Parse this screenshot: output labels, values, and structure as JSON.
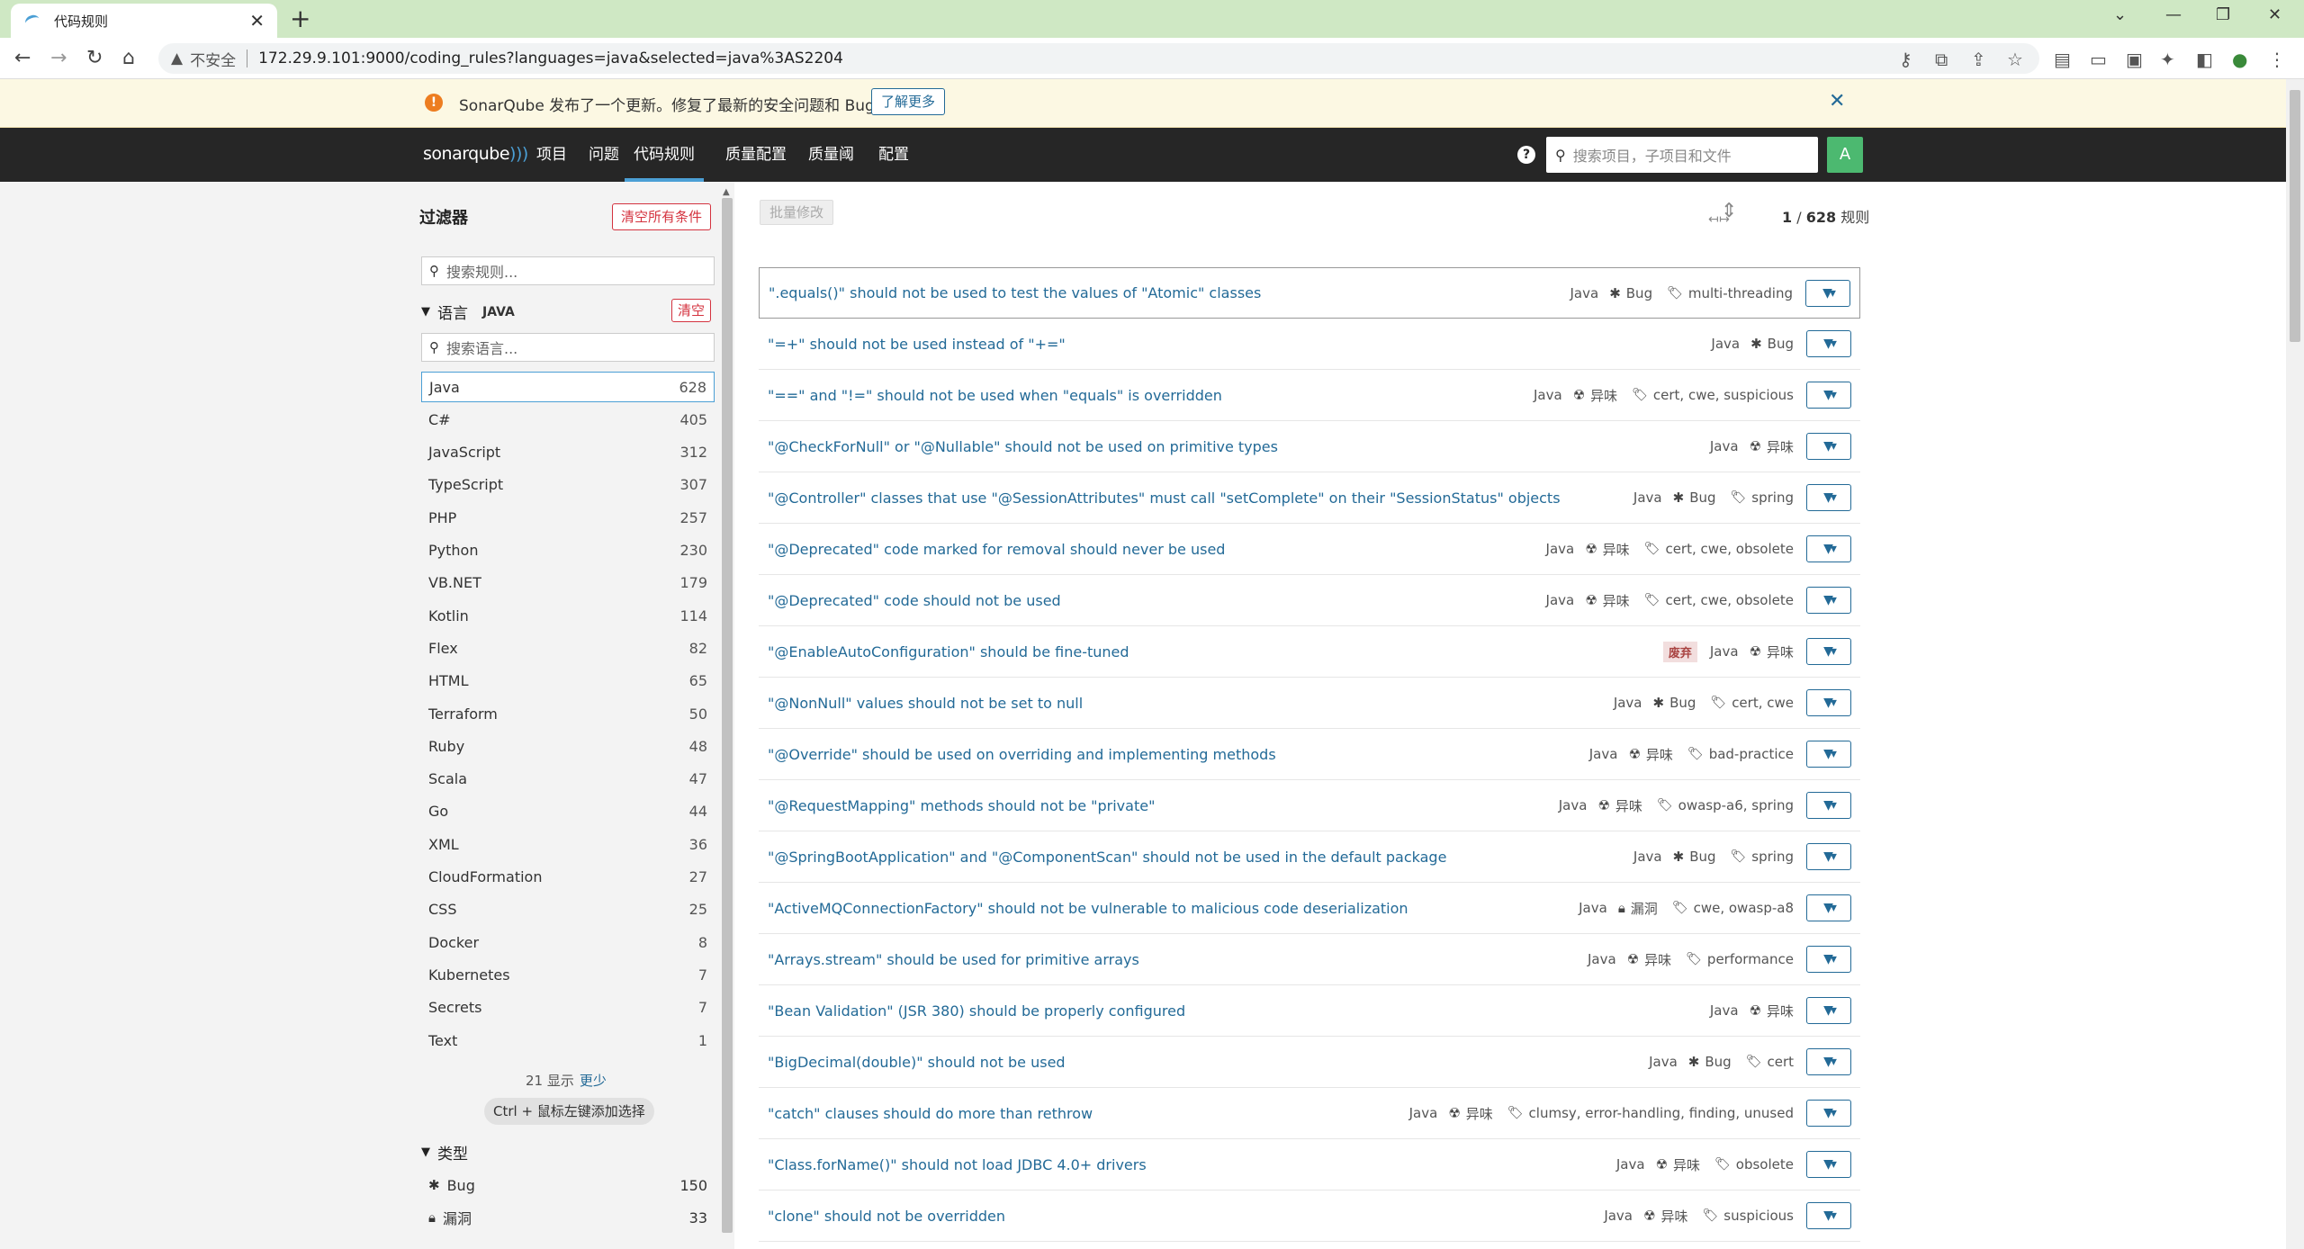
{
  "browser": {
    "tab_title": "代码规则",
    "insecure_label": "不安全",
    "url": "172.29.9.101:9000/coding_rules?languages=java&selected=java%3AS2204"
  },
  "notice": {
    "message": "SonarQube 发布了一个更新。修复了最新的安全问题和 Bug。",
    "learn_more": "了解更多"
  },
  "nav": {
    "logo": "sonarqube",
    "items": [
      "项目",
      "问题",
      "代码规则",
      "质量配置",
      "质量阈",
      "配置"
    ],
    "active": "代码规则",
    "search_placeholder": "搜索项目，子项目和文件",
    "avatar": "A"
  },
  "sidebar": {
    "title": "过滤器",
    "clear_all": "清空所有条件",
    "search_placeholder": "搜索规则...",
    "language_facet": {
      "label": "语言",
      "selected": "JAVA",
      "clear": "清空",
      "search_placeholder": "搜索语言...",
      "items": [
        {
          "name": "Java",
          "count": "628"
        },
        {
          "name": "C#",
          "count": "405"
        },
        {
          "name": "JavaScript",
          "count": "312"
        },
        {
          "name": "TypeScript",
          "count": "307"
        },
        {
          "name": "PHP",
          "count": "257"
        },
        {
          "name": "Python",
          "count": "230"
        },
        {
          "name": "VB.NET",
          "count": "179"
        },
        {
          "name": "Kotlin",
          "count": "114"
        },
        {
          "name": "Flex",
          "count": "82"
        },
        {
          "name": "HTML",
          "count": "65"
        },
        {
          "name": "Terraform",
          "count": "50"
        },
        {
          "name": "Ruby",
          "count": "48"
        },
        {
          "name": "Scala",
          "count": "47"
        },
        {
          "name": "Go",
          "count": "44"
        },
        {
          "name": "XML",
          "count": "36"
        },
        {
          "name": "CloudFormation",
          "count": "27"
        },
        {
          "name": "CSS",
          "count": "25"
        },
        {
          "name": "Docker",
          "count": "8"
        },
        {
          "name": "Kubernetes",
          "count": "7"
        },
        {
          "name": "Secrets",
          "count": "7"
        },
        {
          "name": "Text",
          "count": "1"
        }
      ],
      "shown": "21 显示",
      "show_less": "更少",
      "ctrl_hint": "Ctrl + 鼠标左键添加选择"
    },
    "type_facet": {
      "label": "类型",
      "items": [
        {
          "name": "Bug",
          "count": "150",
          "icon": "bug-icon"
        },
        {
          "name": "漏洞",
          "count": "33",
          "icon": "lock-icon"
        }
      ]
    }
  },
  "main": {
    "bulk_change": "批量修改",
    "paging_current": "1",
    "paging_sep": " / ",
    "paging_total": "628",
    "paging_unit": " 规则",
    "rules": [
      {
        "name": "\".equals()\" should not be used to test the values of \"Atomic\" classes",
        "lang": "Java",
        "type": "Bug",
        "icon": "bug-icon",
        "tags": "multi-threading",
        "deprecated": ""
      },
      {
        "name": "\"=+\" should not be used instead of \"+=\"",
        "lang": "Java",
        "type": "Bug",
        "icon": "bug-icon",
        "tags": "",
        "deprecated": ""
      },
      {
        "name": "\"==\" and \"!=\" should not be used when \"equals\" is overridden",
        "lang": "Java",
        "type": "异味",
        "icon": "code-smell-icon",
        "tags": "cert, cwe, suspicious",
        "deprecated": ""
      },
      {
        "name": "\"@CheckForNull\" or \"@Nullable\" should not be used on primitive types",
        "lang": "Java",
        "type": "异味",
        "icon": "code-smell-icon",
        "tags": "",
        "deprecated": ""
      },
      {
        "name": "\"@Controller\" classes that use \"@SessionAttributes\" must call \"setComplete\" on their \"SessionStatus\" objects",
        "lang": "Java",
        "type": "Bug",
        "icon": "bug-icon",
        "tags": "spring",
        "deprecated": ""
      },
      {
        "name": "\"@Deprecated\" code marked for removal should never be used",
        "lang": "Java",
        "type": "异味",
        "icon": "code-smell-icon",
        "tags": "cert, cwe, obsolete",
        "deprecated": ""
      },
      {
        "name": "\"@Deprecated\" code should not be used",
        "lang": "Java",
        "type": "异味",
        "icon": "code-smell-icon",
        "tags": "cert, cwe, obsolete",
        "deprecated": ""
      },
      {
        "name": "\"@EnableAutoConfiguration\" should be fine-tuned",
        "lang": "Java",
        "type": "异味",
        "icon": "code-smell-icon",
        "tags": "",
        "deprecated": "废弃"
      },
      {
        "name": "\"@NonNull\" values should not be set to null",
        "lang": "Java",
        "type": "Bug",
        "icon": "bug-icon",
        "tags": "cert, cwe",
        "deprecated": ""
      },
      {
        "name": "\"@Override\" should be used on overriding and implementing methods",
        "lang": "Java",
        "type": "异味",
        "icon": "code-smell-icon",
        "tags": "bad-practice",
        "deprecated": ""
      },
      {
        "name": "\"@RequestMapping\" methods should not be \"private\"",
        "lang": "Java",
        "type": "异味",
        "icon": "code-smell-icon",
        "tags": "owasp-a6, spring",
        "deprecated": ""
      },
      {
        "name": "\"@SpringBootApplication\" and \"@ComponentScan\" should not be used in the default package",
        "lang": "Java",
        "type": "Bug",
        "icon": "bug-icon",
        "tags": "spring",
        "deprecated": ""
      },
      {
        "name": "\"ActiveMQConnectionFactory\" should not be vulnerable to malicious code deserialization",
        "lang": "Java",
        "type": "漏洞",
        "icon": "lock-icon",
        "tags": "cwe, owasp-a8",
        "deprecated": ""
      },
      {
        "name": "\"Arrays.stream\" should be used for primitive arrays",
        "lang": "Java",
        "type": "异味",
        "icon": "code-smell-icon",
        "tags": "performance",
        "deprecated": ""
      },
      {
        "name": "\"Bean Validation\" (JSR 380) should be properly configured",
        "lang": "Java",
        "type": "异味",
        "icon": "code-smell-icon",
        "tags": "",
        "deprecated": ""
      },
      {
        "name": "\"BigDecimal(double)\" should not be used",
        "lang": "Java",
        "type": "Bug",
        "icon": "bug-icon",
        "tags": "cert",
        "deprecated": ""
      },
      {
        "name": "\"catch\" clauses should do more than rethrow",
        "lang": "Java",
        "type": "异味",
        "icon": "code-smell-icon",
        "tags": "clumsy, error-handling, finding, unused",
        "deprecated": ""
      },
      {
        "name": "\"Class.forName()\" should not load JDBC 4.0+ drivers",
        "lang": "Java",
        "type": "异味",
        "icon": "code-smell-icon",
        "tags": "obsolete",
        "deprecated": ""
      },
      {
        "name": "\"clone\" should not be overridden",
        "lang": "Java",
        "type": "异味",
        "icon": "code-smell-icon",
        "tags": "suspicious",
        "deprecated": ""
      }
    ]
  }
}
